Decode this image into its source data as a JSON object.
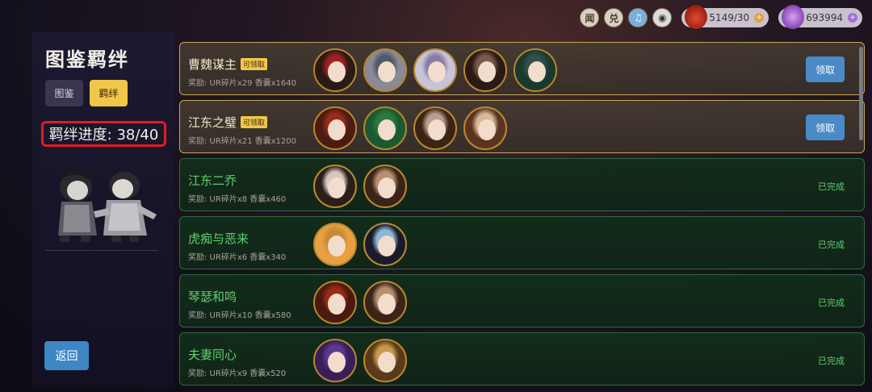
{
  "topbar": {
    "buttons": [
      {
        "label": "闻",
        "icon": "wen-icon"
      },
      {
        "label": "兑",
        "icon": "exchange-icon"
      },
      {
        "label": "♫",
        "icon": "music-icon"
      },
      {
        "label": "◉",
        "icon": "eye-icon"
      }
    ],
    "stamina": "5149/30",
    "gems": "693994"
  },
  "sidebar": {
    "title": "图鉴羁绊",
    "tabs": [
      {
        "label": "图鉴",
        "active": false
      },
      {
        "label": "羁绊",
        "active": true
      }
    ],
    "progress_text": "羁绊进度: 38/40",
    "back_label": "返回"
  },
  "bonds": [
    {
      "name": "曹魏谋主",
      "status": "claim",
      "badge": "可领取",
      "reward": "奖励: UR碎片x29  香囊x1640",
      "action": "领取",
      "avatars": [
        {
          "hair": "#2a1a16",
          "bg": "#a02020"
        },
        {
          "hair": "#8a8a96",
          "bg": "#505a6a"
        },
        {
          "hair": "#c8c4d8",
          "bg": "#8a7aa8"
        },
        {
          "hair": "#2a1a16",
          "bg": "#7a5a4a"
        },
        {
          "hair": "#183a30",
          "bg": "#30504a"
        }
      ]
    },
    {
      "name": "江东之璧",
      "status": "claim",
      "badge": "可领取",
      "reward": "奖励: UR碎片x21  香囊x1200",
      "action": "领取",
      "avatars": [
        {
          "hair": "#4a1c12",
          "bg": "#9a2a18"
        },
        {
          "hair": "#1a5a30",
          "bg": "#2a7a40"
        },
        {
          "hair": "#3a2414",
          "bg": "#b8a090"
        },
        {
          "hair": "#5a3420",
          "bg": "#d8b898"
        }
      ]
    },
    {
      "name": "江东二乔",
      "status": "done",
      "badge": "",
      "reward": "奖励: UR碎片x8  香囊x460",
      "action": "已完成",
      "avatars": [
        {
          "hair": "#2a1e1a",
          "bg": "#d8c8c0"
        },
        {
          "hair": "#3a2418",
          "bg": "#b89070"
        }
      ]
    },
    {
      "name": "虎痴与恶来",
      "status": "done",
      "badge": "",
      "reward": "奖励: UR碎片x6  香囊x340",
      "action": "已完成",
      "avatars": [
        {
          "hair": "#e8a040",
          "bg": "#c88a3a"
        },
        {
          "hair": "#1a1a2a",
          "bg": "#8ab8d8"
        }
      ]
    },
    {
      "name": "琴瑟和鸣",
      "status": "done",
      "badge": "",
      "reward": "奖励: UR碎片x10  香囊x580",
      "action": "已完成",
      "avatars": [
        {
          "hair": "#4a1a10",
          "bg": "#9a2a18"
        },
        {
          "hair": "#3a2418",
          "bg": "#b89070"
        }
      ]
    },
    {
      "name": "夫妻同心",
      "status": "done",
      "badge": "",
      "reward": "奖励: UR碎片x9  香囊x520",
      "action": "已完成",
      "avatars": [
        {
          "hair": "#3a1e5a",
          "bg": "#5a3a8a"
        },
        {
          "hair": "#5a3a18",
          "bg": "#c89a50"
        }
      ]
    }
  ]
}
